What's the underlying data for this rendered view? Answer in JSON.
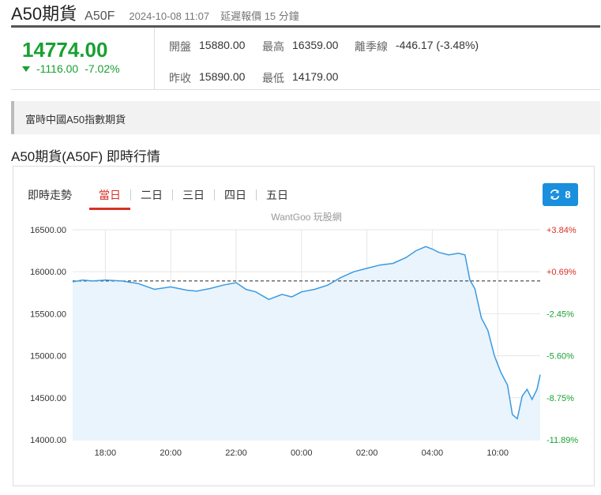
{
  "header": {
    "name": "A50期貨",
    "code": "A50F",
    "time": "2024-10-08 11:07",
    "delay": "延遲報價 15 分鐘"
  },
  "quote": {
    "price": "14774.00",
    "change": "-1116.00",
    "change_pct": "-7.02%",
    "open_label": "開盤",
    "open": "15880.00",
    "high_label": "最高",
    "high": "16359.00",
    "gap_label": "離季線",
    "gap": "-446.17 (-3.48%)",
    "prev_label": "昨收",
    "prev": "15890.00",
    "low_label": "最低",
    "low": "14179.00"
  },
  "description": "富時中國A50指數期貨",
  "section_title": "A50期貨(A50F) 即時行情",
  "chart_panel": {
    "trend_label": "即時走勢",
    "tabs": [
      "當日",
      "二日",
      "三日",
      "四日",
      "五日"
    ],
    "active_tab": 0,
    "refresh_count": "8",
    "watermark": "WantGoo 玩股網"
  },
  "colors": {
    "up": "#d93025",
    "down": "#19a032",
    "line": "#3b9ae1",
    "fill": "#eaf4fc",
    "accent": "#1a8fde"
  },
  "chart_data": {
    "type": "area",
    "reference_price": 15890,
    "ylim": [
      14000,
      16500
    ],
    "yticks": [
      "16500.00",
      "16000.00",
      "15500.00",
      "15000.00",
      "14500.00",
      "14000.00"
    ],
    "ytick_values": [
      16500,
      16000,
      15500,
      15000,
      14500,
      14000
    ],
    "pct_ticks": [
      "+3.84%",
      "+0.69%",
      "-2.45%",
      "-5.60%",
      "-8.75%",
      "-11.89%"
    ],
    "xticks": [
      "18:00",
      "20:00",
      "22:00",
      "00:00",
      "02:00",
      "04:00",
      "10:00"
    ],
    "xtick_hours": [
      1,
      3,
      5,
      7,
      9,
      11,
      13
    ],
    "xlim": [
      0,
      14.3
    ],
    "x": [
      0,
      0.3,
      0.6,
      1.0,
      1.5,
      2.0,
      2.5,
      3.0,
      3.5,
      3.8,
      4.2,
      4.6,
      5.0,
      5.3,
      5.6,
      6.0,
      6.4,
      6.7,
      7.0,
      7.4,
      7.8,
      8.2,
      8.6,
      9.0,
      9.4,
      9.8,
      10.2,
      10.5,
      10.8,
      11.0,
      11.2,
      11.5,
      11.8,
      12.0,
      12.15,
      12.3,
      12.5,
      12.7,
      12.9,
      13.1,
      13.3,
      13.45,
      13.6,
      13.75,
      13.9,
      14.05,
      14.2,
      14.3
    ],
    "values": [
      15880,
      15900,
      15890,
      15900,
      15890,
      15860,
      15790,
      15820,
      15780,
      15770,
      15800,
      15840,
      15870,
      15790,
      15760,
      15670,
      15730,
      15700,
      15760,
      15790,
      15840,
      15930,
      16000,
      16040,
      16080,
      16100,
      16170,
      16250,
      16300,
      16270,
      16230,
      16200,
      16220,
      16200,
      15900,
      15800,
      15450,
      15300,
      15000,
      14800,
      14650,
      14300,
      14250,
      14520,
      14600,
      14480,
      14600,
      14774
    ]
  }
}
